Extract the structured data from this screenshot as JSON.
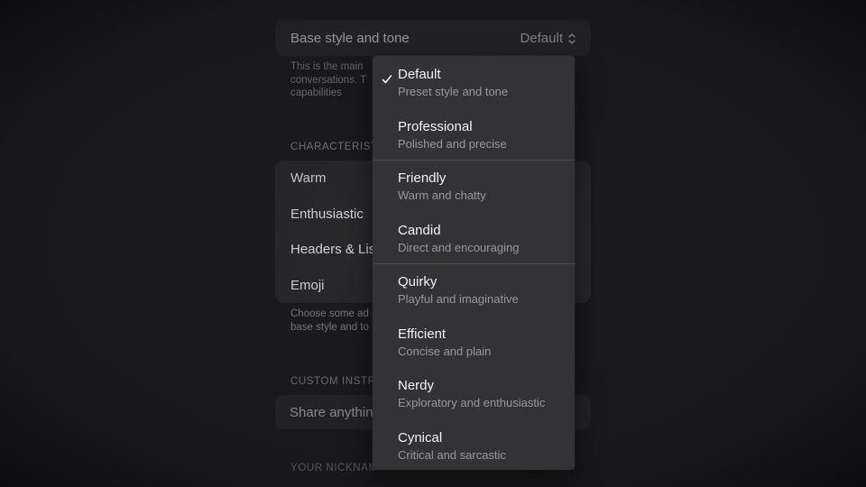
{
  "base_style": {
    "label": "Base style and tone",
    "value": "Default",
    "description_lines": [
      "This is the main",
      "conversations. T",
      "capabilities"
    ]
  },
  "characteristics": {
    "header": "CHARACTERISTI",
    "rows": [
      "Warm",
      "Enthusiastic",
      "Headers & Lis",
      "Emoji"
    ],
    "description_lines": [
      "Choose some ad",
      "base style and to"
    ]
  },
  "custom_instructions": {
    "header": "CUSTOM INSTRU",
    "placeholder": "Share anythin"
  },
  "nickname": {
    "header": "YOUR NICKNAME"
  },
  "menu": {
    "selected_index": 0,
    "items": [
      {
        "title": "Default",
        "subtitle": "Preset style and tone",
        "selected": true
      },
      {
        "title": "Professional",
        "subtitle": "Polished and precise",
        "selected": false
      },
      {
        "title": "Friendly",
        "subtitle": "Warm and chatty",
        "selected": false
      },
      {
        "title": "Candid",
        "subtitle": "Direct and encouraging",
        "selected": false
      },
      {
        "title": "Quirky",
        "subtitle": "Playful and imaginative",
        "selected": false
      },
      {
        "title": "Efficient",
        "subtitle": "Concise and plain",
        "selected": false
      },
      {
        "title": "Nerdy",
        "subtitle": "Exploratory and enthusiastic",
        "selected": false
      },
      {
        "title": "Cynical",
        "subtitle": "Critical and sarcastic",
        "selected": false
      }
    ]
  },
  "colors": {
    "background": "#1c1c1e",
    "card": "#2b2b2e",
    "menu": "#333336",
    "primary_text": "#ececee",
    "secondary_text": "#8d8d92"
  }
}
